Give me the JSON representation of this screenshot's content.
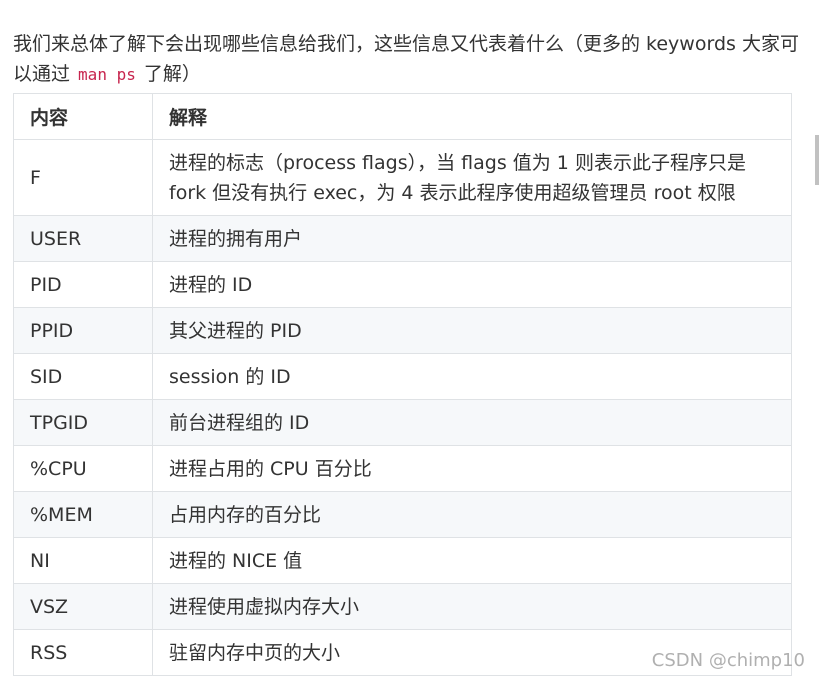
{
  "intro": {
    "text_before": "我们来总体了解下会出现哪些信息给我们，这些信息又代表着什么（更多的 keywords 大家可以通过 ",
    "code": "man ps",
    "text_after": " 了解）"
  },
  "table": {
    "headers": [
      "内容",
      "解释"
    ],
    "rows": [
      [
        "F",
        "进程的标志（process flags），当 flags 值为 1 则表示此子程序只是 fork 但没有执行 exec，为 4 表示此程序使用超级管理员 root 权限"
      ],
      [
        "USER",
        "进程的拥有用户"
      ],
      [
        "PID",
        "进程的 ID"
      ],
      [
        "PPID",
        "其父进程的 PID"
      ],
      [
        "SID",
        "session 的 ID"
      ],
      [
        "TPGID",
        "前台进程组的 ID"
      ],
      [
        "%CPU",
        "进程占用的 CPU 百分比"
      ],
      [
        "%MEM",
        "占用内存的百分比"
      ],
      [
        "NI",
        "进程的 NICE 值"
      ],
      [
        "VSZ",
        "进程使用虚拟内存大小"
      ],
      [
        "RSS",
        "驻留内存中页的大小"
      ]
    ]
  },
  "watermark": "CSDN @chimp10"
}
